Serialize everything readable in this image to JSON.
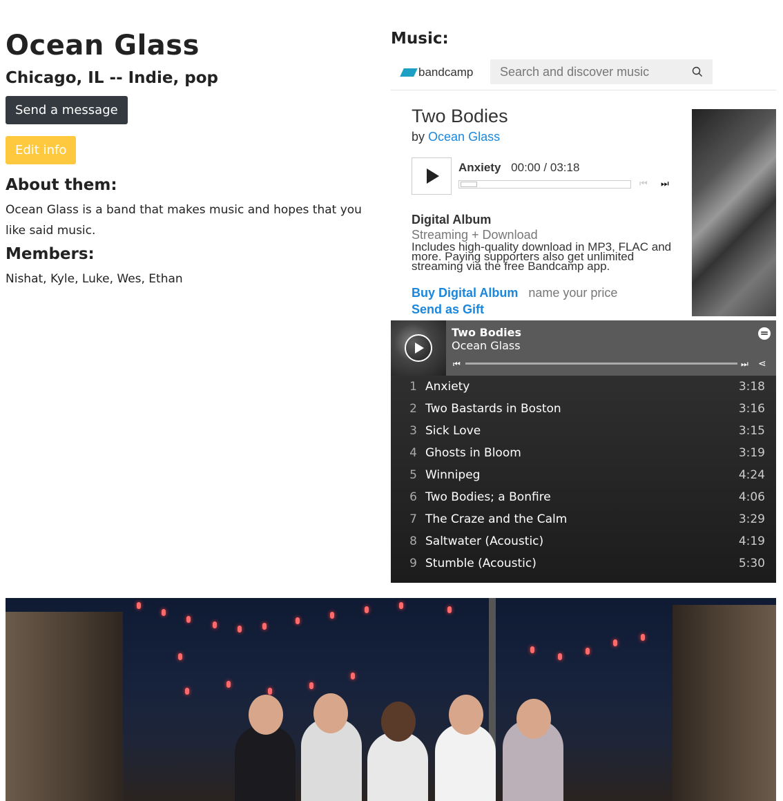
{
  "profile": {
    "name": "Ocean Glass",
    "subtitle": "Chicago, IL -- Indie, pop",
    "message_button": "Send a message",
    "edit_button": "Edit info",
    "about_heading": "About them:",
    "about_text": "Ocean Glass is a band that makes music and hopes that you like said music.",
    "members_heading": "Members:",
    "members_text": "Nishat, Kyle, Luke, Wes, Ethan"
  },
  "music": {
    "heading": "Music:"
  },
  "bandcamp": {
    "logo_text": "bandcamp",
    "search_placeholder": "Search and discover music",
    "album_title": "Two Bodies",
    "by_prefix": "by",
    "artist": "Ocean Glass",
    "current_track": "Anxiety",
    "time": "00:00 / 03:18",
    "format_title": "Digital Album",
    "format_sub": "Streaming + Download",
    "description": "Includes high-quality download in MP3, FLAC and more. Paying supporters also get unlimited streaming via the free Bandcamp app.",
    "buy_label": "Buy Digital Album",
    "price_label": "name your price",
    "gift_label": "Send as Gift",
    "progress": 0,
    "colors": {
      "link": "#1a87dd",
      "logo": "#1da0c3"
    }
  },
  "spotify": {
    "title": "Two Bodies",
    "artist": "Ocean Glass",
    "tracks": [
      {
        "num": "1",
        "title": "Anxiety",
        "duration": "3:18"
      },
      {
        "num": "2",
        "title": "Two Bastards in Boston",
        "duration": "3:16"
      },
      {
        "num": "3",
        "title": "Sick Love",
        "duration": "3:15"
      },
      {
        "num": "4",
        "title": "Ghosts in Bloom",
        "duration": "3:19"
      },
      {
        "num": "5",
        "title": "Winnipeg",
        "duration": "4:24"
      },
      {
        "num": "6",
        "title": "Two Bodies; a Bonfire",
        "duration": "4:06"
      },
      {
        "num": "7",
        "title": "The Craze and the Calm",
        "duration": "3:29"
      },
      {
        "num": "8",
        "title": "Saltwater (Acoustic)",
        "duration": "4:19"
      },
      {
        "num": "9",
        "title": "Stumble (Acoustic)",
        "duration": "5:30"
      }
    ]
  },
  "colors": {
    "dark_button": "#343a40",
    "yellow_button": "#ffc93f"
  }
}
